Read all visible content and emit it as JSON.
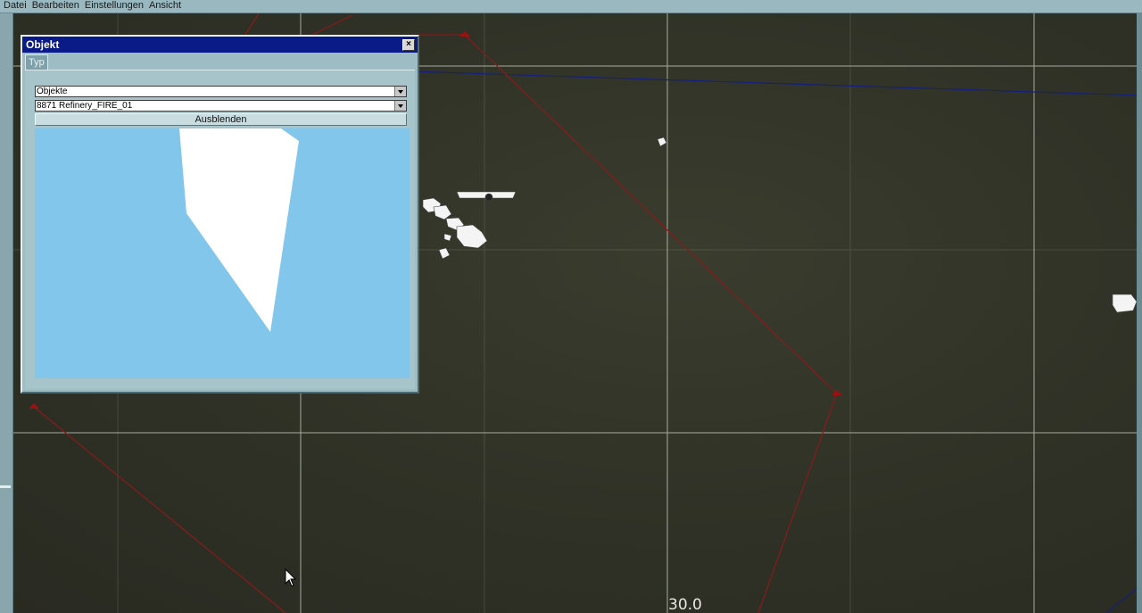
{
  "menu": {
    "items": [
      "Datei",
      "Bearbeiten",
      "Einstellungen",
      "Ansicht"
    ]
  },
  "dialog": {
    "title": "Objekt",
    "close_label": "×",
    "tab_label": "Typ",
    "category_select": "Objekte",
    "object_select": "8871 Refinery_FIRE_01",
    "hide_button": "Ausblenden"
  },
  "map": {
    "scale_label": "30.0",
    "colors": {
      "route": "#8a1a1a",
      "border": "#16207a",
      "grid": "#cfd3c6",
      "preview_bg": "#82c6ec"
    }
  }
}
